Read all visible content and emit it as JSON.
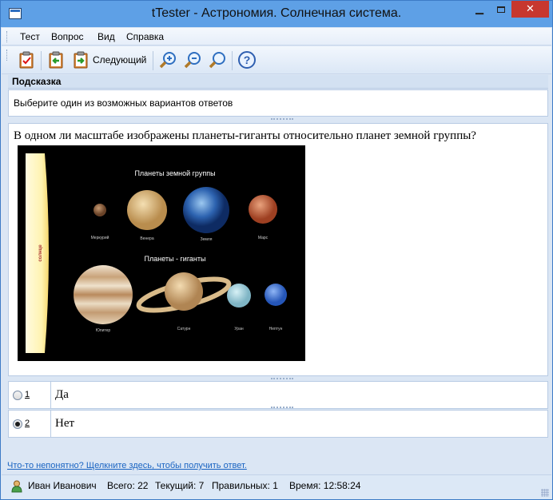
{
  "window": {
    "title": "tTester - Астрономия. Солнечная система."
  },
  "menu": {
    "items": [
      "Тест",
      "Вопрос",
      "Вид",
      "Справка"
    ]
  },
  "toolbar": {
    "next_label": "Следующий",
    "buttons": [
      "finish-test",
      "previous-question",
      "next-question",
      "zoom-in",
      "zoom-out",
      "zoom-reset",
      "help"
    ]
  },
  "hint": {
    "header": "Подсказка",
    "text": "Выберите один из возможных вариантов ответов"
  },
  "question": {
    "text": "В одном ли масштабе  изображены планеты-гиганты относительно планет земной группы?",
    "image": {
      "sun_label": "солнце",
      "terrestrial_title": "Планеты земной группы",
      "giants_title": "Планеты - гиганты",
      "terrestrial": [
        "Меркурий",
        "Венера",
        "Земля",
        "Марс"
      ],
      "giants": [
        "Юпитер",
        "Сатурн",
        "Уран",
        "Нептун"
      ]
    }
  },
  "answers": [
    {
      "index": "1",
      "text": "Да",
      "selected": false
    },
    {
      "index": "2",
      "text": "Нет",
      "selected": true
    }
  ],
  "help_link": "Что-то непонятно? Щелкните здесь, чтобы получить ответ.",
  "status": {
    "user": "Иван Иванович",
    "total": "Всего: 22",
    "current": "Текущий: 7",
    "correct": "Правильных: 1",
    "time": "Время: 12:58:24"
  },
  "colors": {
    "accent": "#5ea0e6",
    "link": "#1a64c2",
    "close": "#c7372f"
  }
}
